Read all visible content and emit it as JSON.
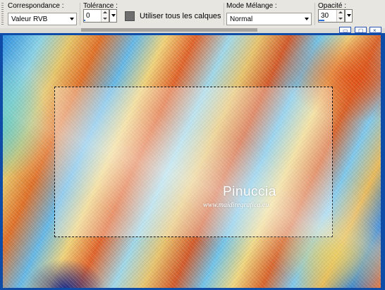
{
  "toolbar": {
    "correspondance": {
      "label": "Correspondance :",
      "value": "Valeur RVB"
    },
    "tolerance": {
      "label": "Tolérance :",
      "value": "0"
    },
    "all_layers": {
      "label": "Utiliser tous les calques",
      "checked": false
    },
    "blend_mode": {
      "label": "Mode Mélange :",
      "value": "Normal"
    },
    "opacity": {
      "label": "Opacité :",
      "value": "30",
      "fill": 0.3
    }
  },
  "colors": {
    "accent_bar": "#2f6fd6",
    "window_border": "#0e4ca8",
    "selection_marquee": "#111111"
  },
  "canvas": {
    "watermark_name": "Pinuccia",
    "watermark_url": "www.maidiregrafica.eu",
    "selection": "dashed-rectangle"
  },
  "icons": {
    "spin_up": "up-arrow-icon",
    "spin_down": "down-arrow-icon",
    "dropdown": "chevron-down-icon",
    "window_restore": "restore-icon",
    "window_close": "close-icon"
  }
}
